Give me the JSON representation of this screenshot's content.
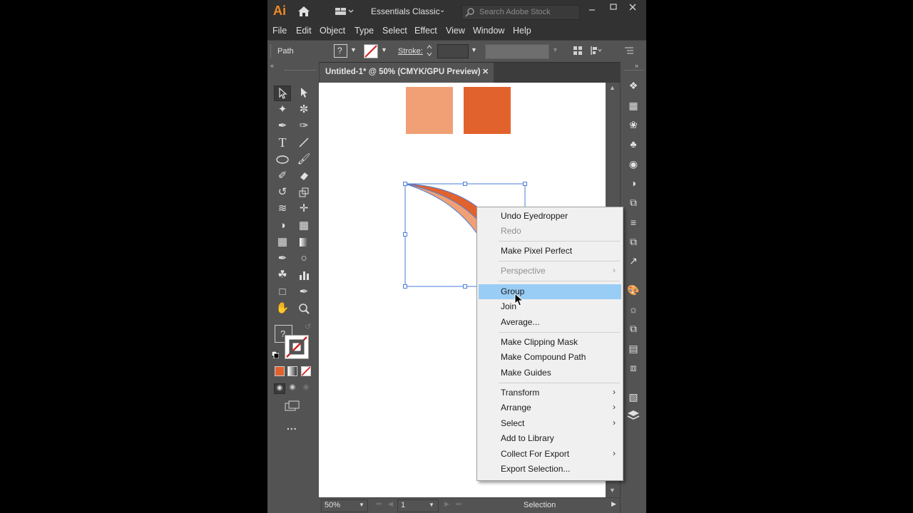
{
  "app": {
    "logo": "Ai",
    "workspace": "Essentials Classic",
    "search_placeholder": "Search Adobe Stock"
  },
  "menu": [
    "File",
    "Edit",
    "Object",
    "Type",
    "Select",
    "Effect",
    "View",
    "Window",
    "Help"
  ],
  "control_bar": {
    "selection_type": "Path",
    "fill_label": "?",
    "stroke_label": "Stroke:"
  },
  "document_tab": {
    "title": "Untitled-1* @ 50% (CMYK/GPU Preview)",
    "close": "✕"
  },
  "colors": {
    "square_light": "#f0a074",
    "square_dark": "#e2622e",
    "highlight": "#99cdf5",
    "selection": "#4a7ed8"
  },
  "context_menu": {
    "items": [
      {
        "label": "Undo Eyedropper",
        "enabled": true
      },
      {
        "label": "Redo",
        "enabled": false
      },
      {
        "label": "Make Pixel Perfect",
        "enabled": true
      },
      {
        "label": "Perspective",
        "enabled": false,
        "submenu": true
      },
      {
        "label": "Group",
        "enabled": true,
        "highlighted": true
      },
      {
        "label": "Join",
        "enabled": true
      },
      {
        "label": "Average...",
        "enabled": true
      },
      {
        "label": "Make Clipping Mask",
        "enabled": true
      },
      {
        "label": "Make Compound Path",
        "enabled": true
      },
      {
        "label": "Make Guides",
        "enabled": true
      },
      {
        "label": "Transform",
        "enabled": true,
        "submenu": true
      },
      {
        "label": "Arrange",
        "enabled": true,
        "submenu": true
      },
      {
        "label": "Select",
        "enabled": true,
        "submenu": true
      },
      {
        "label": "Add to Library",
        "enabled": true
      },
      {
        "label": "Collect For Export",
        "enabled": true,
        "submenu": true
      },
      {
        "label": "Export Selection...",
        "enabled": true
      }
    ]
  },
  "status_bar": {
    "zoom": "50%",
    "artboard": "1",
    "tool": "Selection"
  },
  "tools": {
    "fill_question": "?",
    "more": "..."
  }
}
